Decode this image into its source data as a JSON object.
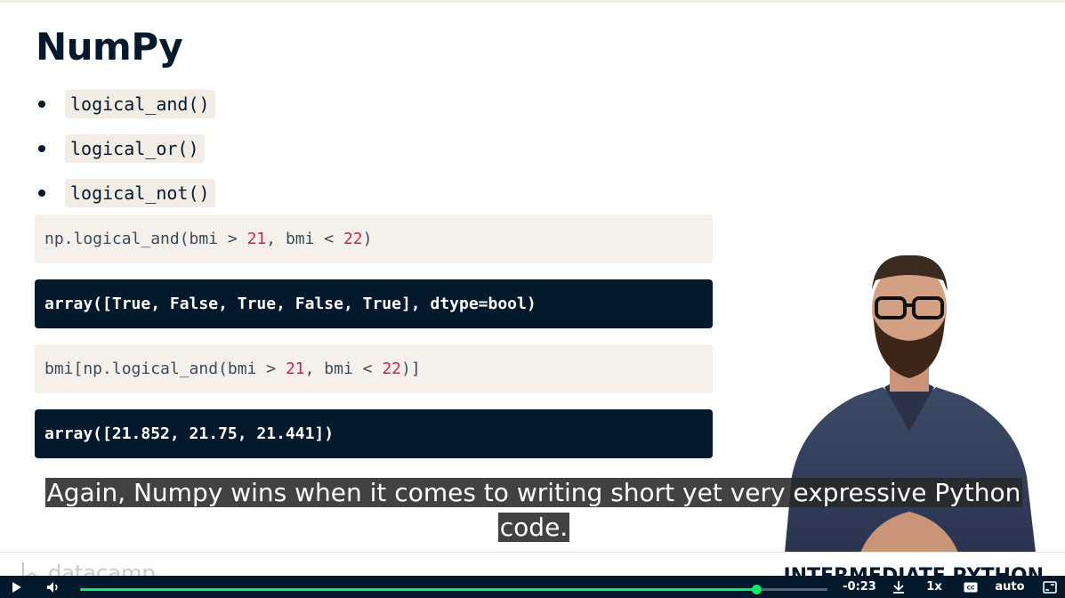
{
  "slide": {
    "title": "NumPy",
    "bullets": [
      "logical_and()",
      "logical_or()",
      "logical_not()"
    ],
    "code_blocks": [
      {
        "kind": "input",
        "parts": [
          "np.logical_and(bmi > ",
          "21",
          ", bmi < ",
          "22",
          ")"
        ]
      },
      {
        "kind": "output",
        "text": "array([True, False, True, False, True], dtype=bool)"
      },
      {
        "kind": "input",
        "parts": [
          "bmi[np.logical_and(bmi > ",
          "21",
          ", bmi < ",
          "22",
          ")]"
        ]
      },
      {
        "kind": "output",
        "text": "array([21.852, 21.75, 21.441])"
      }
    ],
    "logo_text": "datacamp",
    "course_label": "INTERMEDIATE PYTHON"
  },
  "subtitle": {
    "line1": "Again, Numpy wins when it comes to writing short yet very expressive Python",
    "line2": "code."
  },
  "player": {
    "time_remaining": "-0:23",
    "speed": "1x",
    "quality": "auto",
    "progress_fraction": 0.905,
    "icons": [
      "play-icon",
      "volume-icon",
      "download-icon",
      "captions-icon",
      "fullscreen-icon"
    ]
  },
  "colors": {
    "navy": "#05192d",
    "accent_green": "#03ef62",
    "code_bg": "#f5f1ea",
    "number_red": "#c7254e"
  }
}
